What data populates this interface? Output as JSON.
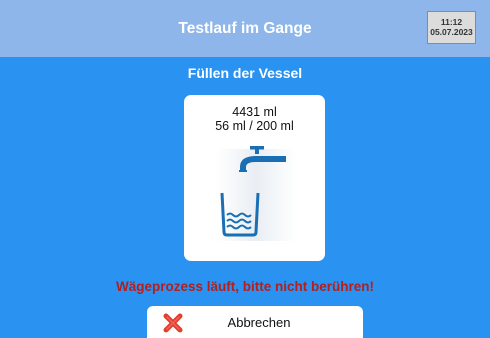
{
  "header": {
    "title": "Testlauf im Gange",
    "clock": {
      "time": "11:12",
      "date": "05.07.2023"
    }
  },
  "main": {
    "subtitle": "Füllen der Vessel",
    "card": {
      "volume_total": "4431 ml",
      "volume_progress": "56 ml / 200 ml",
      "illustration": "faucet-filling-beaker-icon"
    },
    "warning": "Wägeprozess läuft, bitte nicht berühren!"
  },
  "footer": {
    "cancel_label": "Abbrechen",
    "cancel_icon": "red-x-icon"
  },
  "colors": {
    "background": "#2a92f0",
    "titlebar": "#8eb6ea",
    "warning_text": "#b21f1f",
    "icon_blue": "#1a6fb4",
    "cancel_icon": "#e23d2f"
  }
}
